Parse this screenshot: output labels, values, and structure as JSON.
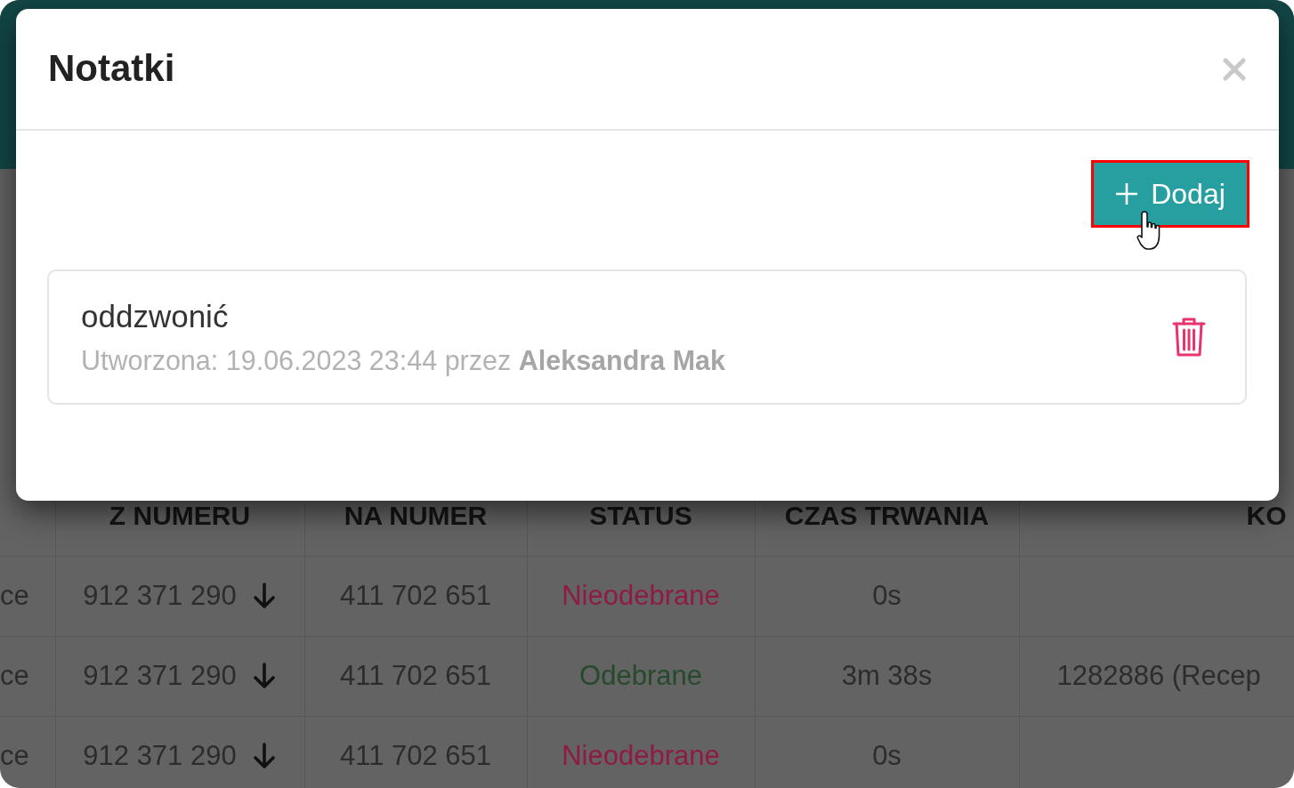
{
  "table": {
    "columns": [
      "Z NUMERU",
      "NA NUMER",
      "STATUS",
      "CZAS TRWANIA",
      "KO"
    ],
    "rows": [
      {
        "column_1": "ce",
        "from": "912 371 290",
        "to": "411 702 651",
        "status": {
          "text": "Nieodebrane",
          "color": "#8e1a45"
        },
        "duration": "0s"
      },
      {
        "column_1": "ce",
        "from": "912 371 290",
        "to": "411 702 651",
        "status": {
          "text": "Odebrane",
          "color": "#27492c"
        },
        "duration": "3m 38s",
        "column_6": "1282886 (Recep"
      },
      {
        "column_1": "ce",
        "from": "912 371 290",
        "to": "411 702 651",
        "status": {
          "text": "Nieodebrane",
          "color": "#8e1a45"
        },
        "duration": "0s"
      }
    ]
  },
  "modal": {
    "title": "Notatki",
    "add_button": {
      "label": "Dodaj",
      "highlighted": true
    },
    "notes": [
      {
        "text": "oddzwonić",
        "meta": "Utworzona: 19.06.2023 23:44 przez **Aleksandra Mak**"
      }
    ]
  }
}
